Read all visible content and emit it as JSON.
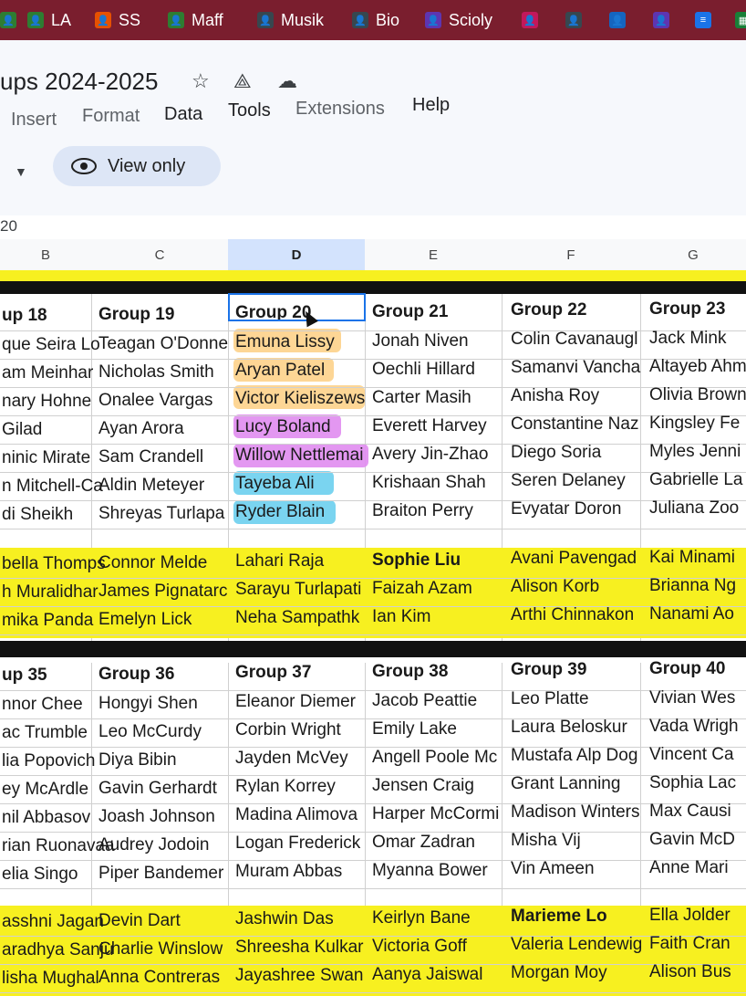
{
  "bookmarks": [
    {
      "label": "",
      "icon": "bookmark-icon",
      "color": "#2e7d32"
    },
    {
      "label": "LA",
      "icon": "classroom-icon",
      "color": "#2e7d32"
    },
    {
      "label": "SS",
      "icon": "classroom-icon",
      "color": "#e65100"
    },
    {
      "label": "Maff",
      "icon": "classroom-icon",
      "color": "#2e7d32"
    },
    {
      "label": "Musik",
      "icon": "classroom-icon",
      "color": "#37474f"
    },
    {
      "label": "Bio",
      "icon": "classroom-icon",
      "color": "#37474f"
    },
    {
      "label": "Scioly",
      "icon": "classroom-icon",
      "color": "#5e35b1"
    },
    {
      "label": "",
      "icon": "classroom-icon",
      "color": "#c2185b"
    },
    {
      "label": "",
      "icon": "classroom-icon",
      "color": "#37474f"
    },
    {
      "label": "",
      "icon": "classroom-icon",
      "color": "#1565c0"
    },
    {
      "label": "",
      "icon": "classroom-icon",
      "color": "#5e35b1"
    },
    {
      "label": "",
      "icon": "docs-icon",
      "color": "#1a73e8"
    },
    {
      "label": "",
      "icon": "sheets-icon",
      "color": "#188038"
    }
  ],
  "doc": {
    "title": "ups 2024-2025"
  },
  "menus": [
    "Insert",
    "Format",
    "Data",
    "Tools",
    "Extensions",
    "Help"
  ],
  "view_only_label": "View only",
  "cell_ref": "20",
  "columns": [
    "B",
    "C",
    "D",
    "E",
    "F",
    "G"
  ],
  "block1": {
    "headers": [
      "up 18",
      "Group 19",
      "Group 20",
      "Group 21",
      "Group 22",
      "Group 23"
    ],
    "rows": [
      [
        "que Seira Lo",
        "Teagan O'Donne",
        "Emuna Lissy",
        "Jonah Niven",
        "Colin Cavanaugl",
        "Jack Mink"
      ],
      [
        "am Meinhar",
        "Nicholas Smith",
        "Aryan Patel",
        "Oechli Hillard",
        "Samanvi Vancha",
        "Altayeb Ahm"
      ],
      [
        "nary Hohne",
        "Onalee Vargas",
        "Victor Kieliszews",
        "Carter Masih",
        "Anisha Roy",
        "Olivia Brown"
      ],
      [
        "Gilad",
        "Ayan Arora",
        "Lucy Boland",
        "Everett Harvey",
        "Constantine Naz",
        "Kingsley Fe"
      ],
      [
        "ninic Mirate",
        "Sam Crandell",
        "Willow Nettlemai",
        "Avery Jin-Zhao",
        "Diego Soria",
        "Myles Jenni"
      ],
      [
        "n Mitchell-Ca",
        "Aldin Meteyer",
        "Tayeba Ali",
        "Krishaan Shah",
        "Seren Delaney",
        "Gabrielle La"
      ],
      [
        "di Sheikh",
        "Shreyas Turlapa",
        "Ryder Blain",
        "Braiton Perry",
        "Evyatar Doron",
        "Juliana Zoo"
      ]
    ],
    "extra": [
      [
        "bella Thomps",
        "Connor Melde",
        "Lahari Raja",
        "Sophie Liu",
        "Avani Pavengad",
        "Kai Minami"
      ],
      [
        "h Muralidhar",
        "James Pignatarc",
        "Sarayu Turlapati",
        "Faizah Azam",
        "Alison Korb",
        "Brianna Ng"
      ],
      [
        "mika Panda",
        "Emelyn Lick",
        "Neha Sampathk",
        "Ian Kim",
        "Arthi Chinnakon",
        "Nanami Ao"
      ]
    ]
  },
  "block2": {
    "headers": [
      "up 35",
      "Group 36",
      "Group 37",
      "Group 38",
      "Group 39",
      "Group 40"
    ],
    "rows": [
      [
        "nnor Chee",
        "Hongyi Shen",
        "Eleanor Diemer",
        "Jacob Peattie",
        "Leo Platte",
        "Vivian Wes"
      ],
      [
        "ac Trumble",
        "Leo McCurdy",
        "Corbin Wright",
        "Emily Lake",
        "Laura Beloskur",
        "Vada Wrigh"
      ],
      [
        "lia Popovich",
        "Diya Bibin",
        "Jayden McVey",
        "Angell Poole Mc",
        "Mustafa Alp Dog",
        "Vincent Ca"
      ],
      [
        "ey McArdle",
        "Gavin Gerhardt",
        "Rylan Korrey",
        "Jensen Craig",
        "Grant Lanning",
        "Sophia Lac"
      ],
      [
        "nil Abbasov",
        "Joash Johnson",
        "Madina Alimova",
        "Harper McCormi",
        "Madison Winters",
        "Max Causi"
      ],
      [
        "rian Ruonavaa",
        "Audrey Jodoin",
        "Logan Frederick",
        "Omar Zadran",
        "Misha Vij",
        "Gavin McD"
      ],
      [
        "elia Singo",
        "Piper Bandemer",
        "Muram Abbas",
        "Myanna Bower",
        "Vin Ameen",
        "Anne Mari"
      ]
    ],
    "extra": [
      [
        "asshni Jagan",
        "Devin Dart",
        "Jashwin Das",
        "Keirlyn Bane",
        "Marieme Lo",
        "Ella Jolder"
      ],
      [
        "aradhya Sanju",
        "Charlie Winslow",
        "Shreesha Kulkar",
        "Victoria Goff",
        "Valeria Lendewig",
        "Faith Cran"
      ],
      [
        "lisha Mughal",
        "Anna Contreras",
        "Jayashree Swan",
        "Aanya Jaiswal",
        "Morgan Moy",
        "Alison Bus"
      ]
    ]
  },
  "highlight_colors": {
    "orange": "#fdd28a",
    "purple": "#e08cf0",
    "blue": "#6ccfee",
    "yellow_band": "#f7f020"
  }
}
